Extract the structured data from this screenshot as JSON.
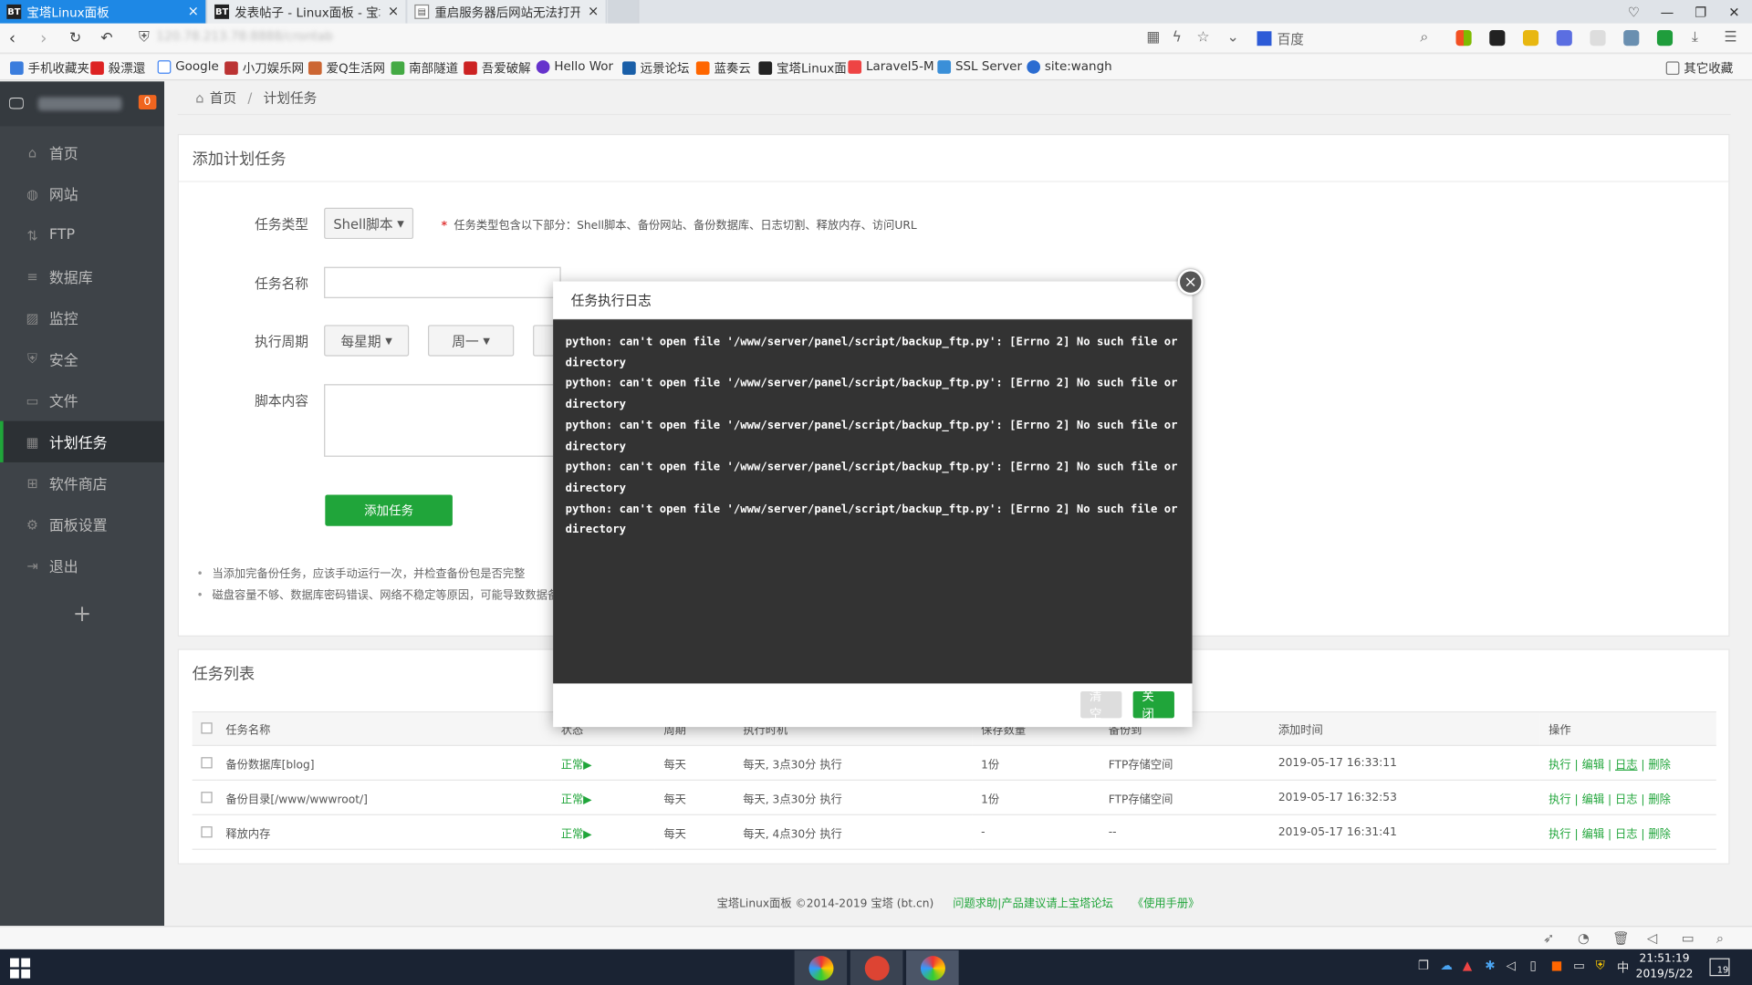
{
  "browser": {
    "tabs": [
      {
        "label": "宝塔Linux面板",
        "active": true
      },
      {
        "label": "发表帖子 - Linux面板 - 宝塔面板",
        "active": false
      },
      {
        "label": "重启服务器后网站无法打开 - 宝塔",
        "active": false
      }
    ],
    "search_engine": "百度",
    "bookmarks": [
      "手机收藏夹",
      "殺漂還",
      "Google",
      "小刀娱乐网",
      "爱Q生活网",
      "南部隧道",
      "吾爱破解",
      "Hello Wor",
      "远景论坛",
      "蓝奏云",
      "宝塔Linux面",
      "Laravel5-M",
      "SSL Server",
      "site:wangh"
    ],
    "other_bookmarks": "其它收藏"
  },
  "sidebar": {
    "badge": "0",
    "items": [
      {
        "label": "首页",
        "icon": "home-icon"
      },
      {
        "label": "网站",
        "icon": "globe-icon"
      },
      {
        "label": "FTP",
        "icon": "ftp-icon"
      },
      {
        "label": "数据库",
        "icon": "database-icon"
      },
      {
        "label": "监控",
        "icon": "monitor-icon"
      },
      {
        "label": "安全",
        "icon": "shield-icon"
      },
      {
        "label": "文件",
        "icon": "folder-icon"
      },
      {
        "label": "计划任务",
        "icon": "calendar-icon",
        "active": true
      },
      {
        "label": "软件商店",
        "icon": "grid-icon"
      },
      {
        "label": "面板设置",
        "icon": "gear-icon"
      },
      {
        "label": "退出",
        "icon": "logout-icon"
      }
    ],
    "add": "+"
  },
  "breadcrumb": {
    "home": "首页",
    "sep": "/",
    "current": "计划任务"
  },
  "add_panel": {
    "title": "添加计划任务",
    "task_type_label": "任务类型",
    "task_type_value": "Shell脚本",
    "task_type_hint_mark": "*",
    "task_type_hint": "任务类型包含以下部分：Shell脚本、备份网站、备份数据库、日志切割、释放内存、访问URL",
    "task_name_label": "任务名称",
    "task_name_value": "",
    "cycle_label": "执行周期",
    "cycle_value": "每星期",
    "weekday_value": "周一",
    "script_label": "脚本内容",
    "add_button": "添加任务",
    "notes": [
      "当添加完备份任务，应该手动运行一次，并检查备份包是否完整",
      "磁盘容量不够、数据库密码错误、网络不稳定等原因，可能导致数据备份"
    ]
  },
  "task_list": {
    "title": "任务列表",
    "columns": [
      "任务名称",
      "状态",
      "周期",
      "执行时机",
      "保存数量",
      "备份到",
      "添加时间",
      "操作"
    ],
    "rows": [
      {
        "name": "备份数据库[blog]",
        "status": "正常▶",
        "cycle": "每天",
        "timing": "每天, 3点30分 执行",
        "keep": "1份",
        "target": "FTP存储空间",
        "added": "2019-05-17 16:33:11",
        "ops": [
          "执行",
          "编辑",
          "日志",
          "删除"
        ]
      },
      {
        "name": "备份目录[/www/wwwroot/]",
        "status": "正常▶",
        "cycle": "每天",
        "timing": "每天, 3点30分 执行",
        "keep": "1份",
        "target": "FTP存储空间",
        "added": "2019-05-17 16:32:53",
        "ops": [
          "执行",
          "编辑",
          "日志",
          "删除"
        ]
      },
      {
        "name": "释放内存",
        "status": "正常▶",
        "cycle": "每天",
        "timing": "每天, 4点30分 执行",
        "keep": "-",
        "target": "--",
        "added": "2019-05-17 16:31:41",
        "ops": [
          "执行",
          "编辑",
          "日志",
          "删除"
        ]
      }
    ],
    "op_sep": "|"
  },
  "footer": {
    "copyright": "宝塔Linux面板 ©2014-2019 宝塔 (bt.cn)",
    "forum": "问题求助|产品建议请上宝塔论坛",
    "manual": "《使用手册》"
  },
  "dialog": {
    "title": "任务执行日志",
    "close_icon": "×",
    "log_lines": [
      "python: can't open file '/www/server/panel/script/backup_ftp.py': [Errno 2] No such file or directory",
      "python: can't open file '/www/server/panel/script/backup_ftp.py': [Errno 2] No such file or directory",
      "python: can't open file '/www/server/panel/script/backup_ftp.py': [Errno 2] No such file or directory",
      "python: can't open file '/www/server/panel/script/backup_ftp.py': [Errno 2] No such file or directory",
      "python: can't open file '/www/server/panel/script/backup_ftp.py': [Errno 2] No such file or directory"
    ],
    "clear_button": "清空",
    "close_button": "关闭"
  },
  "taskbar": {
    "time": "21:51:19",
    "date": "2019/5/22",
    "ime": "中",
    "notifications": "19"
  },
  "colors": {
    "accent": "#20a53a",
    "sidebar": "#3e4348",
    "log_bg": "#333333",
    "tab_active": "#1e88e5"
  }
}
